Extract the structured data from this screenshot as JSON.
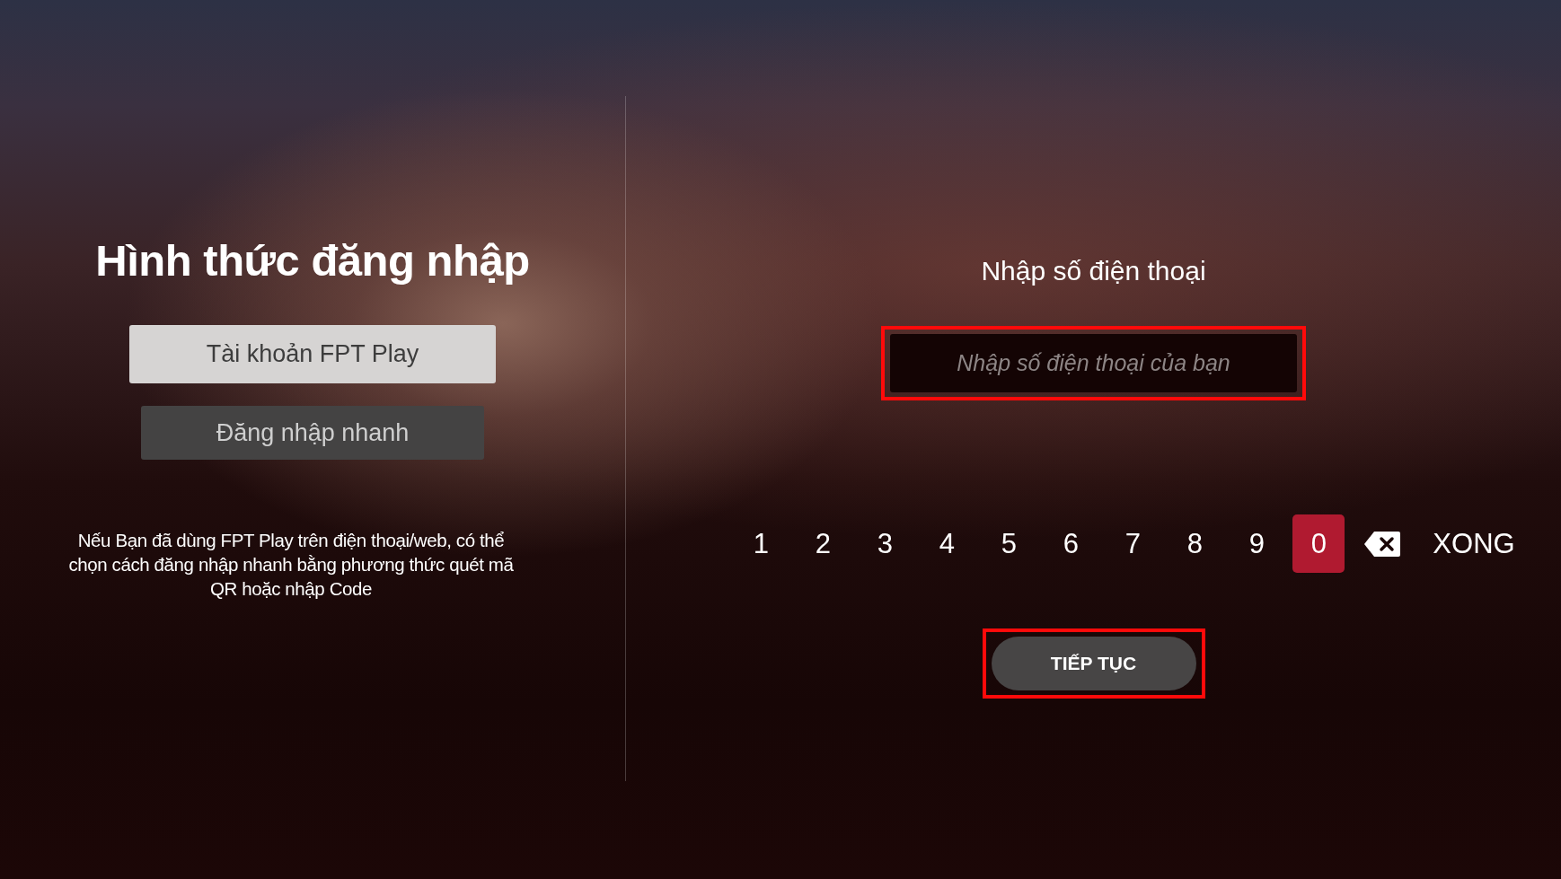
{
  "login_methods": {
    "title": "Hình thức đăng nhập",
    "options": [
      {
        "label": "Tài khoản FPT Play",
        "selected": true
      },
      {
        "label": "Đăng nhập nhanh",
        "selected": false
      }
    ],
    "note": "Nếu Bạn đã dùng FPT Play trên điện thoại/web, có thể chọn cách đăng nhập nhanh bằng phương thức quét mã QR hoặc nhập Code"
  },
  "phone_login": {
    "heading": "Nhập số điện thoại",
    "phone_field": {
      "placeholder": "Nhập số điện thoại của bạn",
      "highlighted": true
    },
    "keypad": [
      {
        "kind": "digit",
        "label": "1",
        "selected": false
      },
      {
        "kind": "digit",
        "label": "2",
        "selected": false
      },
      {
        "kind": "digit",
        "label": "3",
        "selected": false
      },
      {
        "kind": "digit",
        "label": "4",
        "selected": false
      },
      {
        "kind": "digit",
        "label": "5",
        "selected": false
      },
      {
        "kind": "digit",
        "label": "6",
        "selected": false
      },
      {
        "kind": "digit",
        "label": "7",
        "selected": false
      },
      {
        "kind": "digit",
        "label": "8",
        "selected": false
      },
      {
        "kind": "digit",
        "label": "9",
        "selected": false
      },
      {
        "kind": "digit",
        "label": "0",
        "selected": true
      },
      {
        "kind": "backspace",
        "selected": false
      },
      {
        "kind": "done",
        "label": "XONG",
        "selected": false
      }
    ],
    "continue_button": {
      "label": "TIẾP TỤC",
      "highlighted": true
    }
  }
}
